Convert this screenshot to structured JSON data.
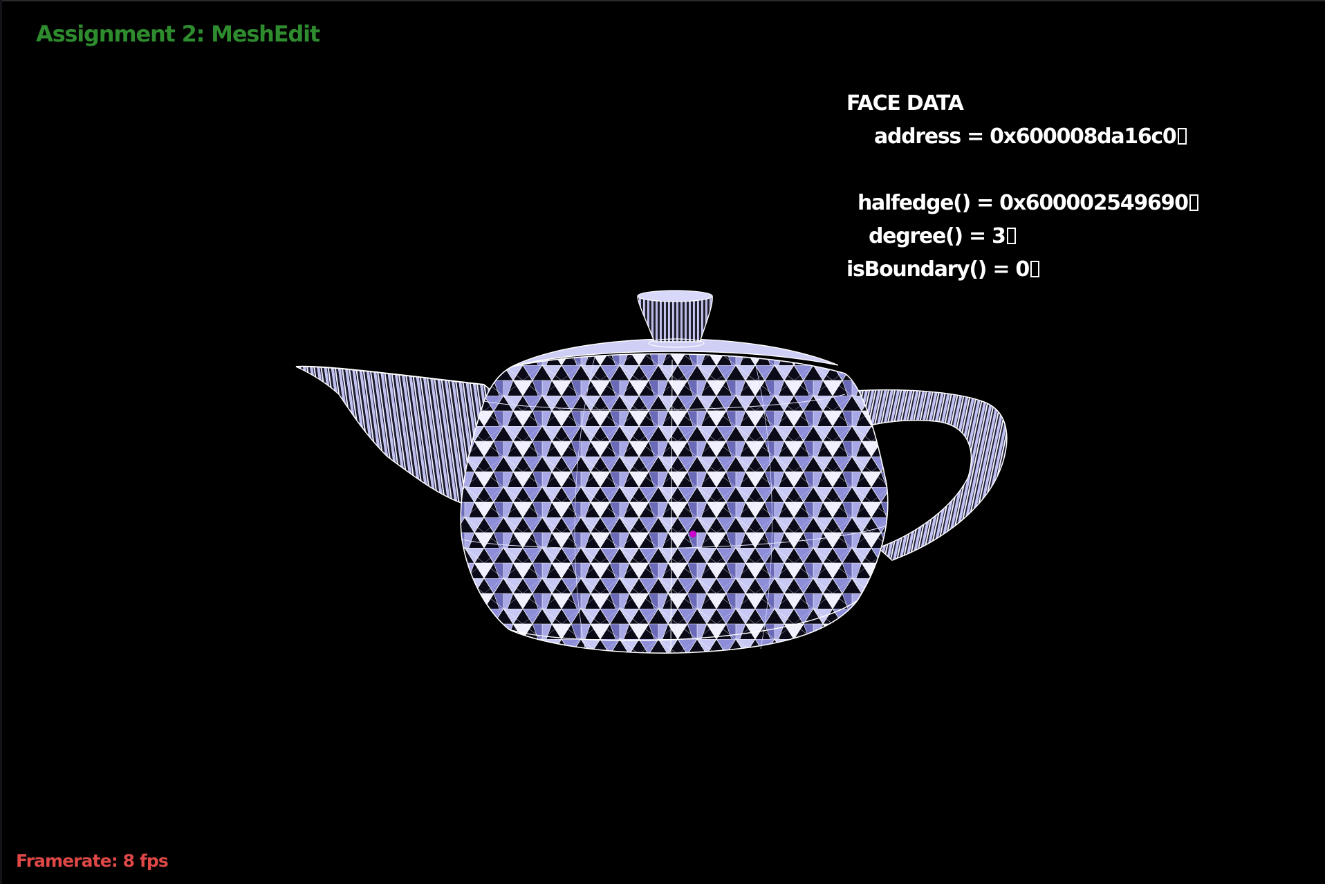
{
  "app": {
    "title": "Assignment 2: MeshEdit"
  },
  "framerate": {
    "label": "Framerate:",
    "value": "8 fps"
  },
  "face_data": {
    "heading": "FACE DATA",
    "address_label": "address",
    "address_value": "0x600008da16c0",
    "halfedge_label": "halfedge()",
    "halfedge_value": "0x600002549690",
    "degree_label": "degree()",
    "degree_value": "3",
    "isboundary_label": "isBoundary()",
    "isboundary_value": "0",
    "equals": " = "
  },
  "colors": {
    "title": "#2e8b2e",
    "framerate": "#e04848",
    "info_text": "#ffffff",
    "mesh_fill": "#b8b8f0",
    "mesh_edge": "#ffffff",
    "selection_marker": "#cc00cc",
    "background": "#000000"
  }
}
